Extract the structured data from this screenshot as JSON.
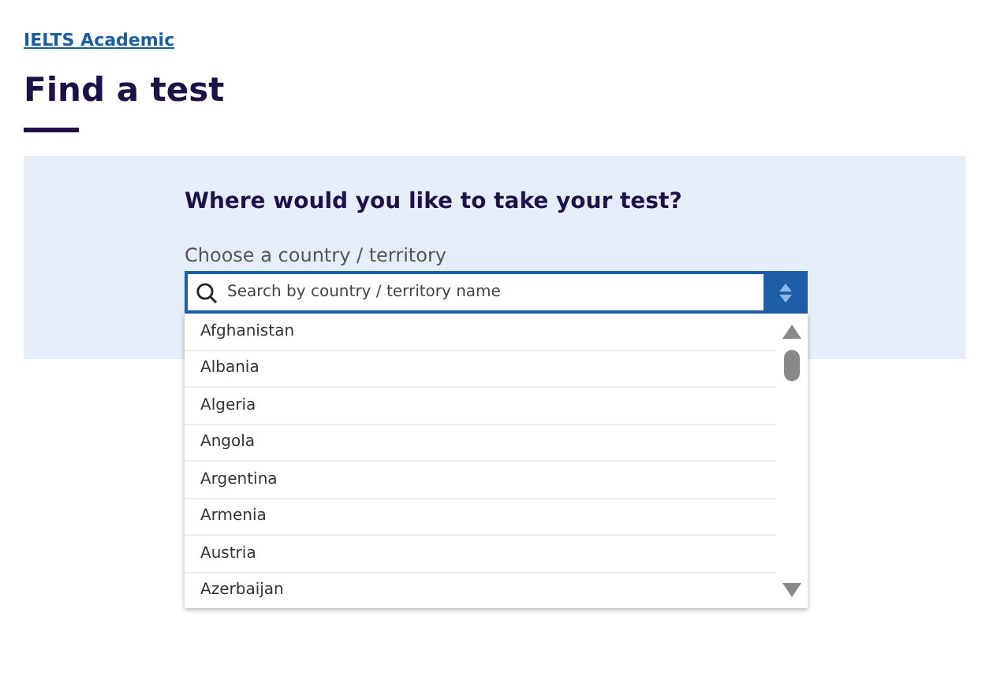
{
  "breadcrumb": "IELTS Academic",
  "heading": "Find a test",
  "question": "Where would you like to take your test?",
  "country_field": {
    "label": "Choose a country / territory",
    "placeholder": "Search by country / territory name"
  },
  "options": [
    {
      "label": "Afghanistan"
    },
    {
      "label": "Albania"
    },
    {
      "label": "Algeria"
    },
    {
      "label": "Angola"
    },
    {
      "label": "Argentina"
    },
    {
      "label": "Armenia"
    },
    {
      "label": "Austria"
    },
    {
      "label": "Azerbaijan"
    }
  ]
}
